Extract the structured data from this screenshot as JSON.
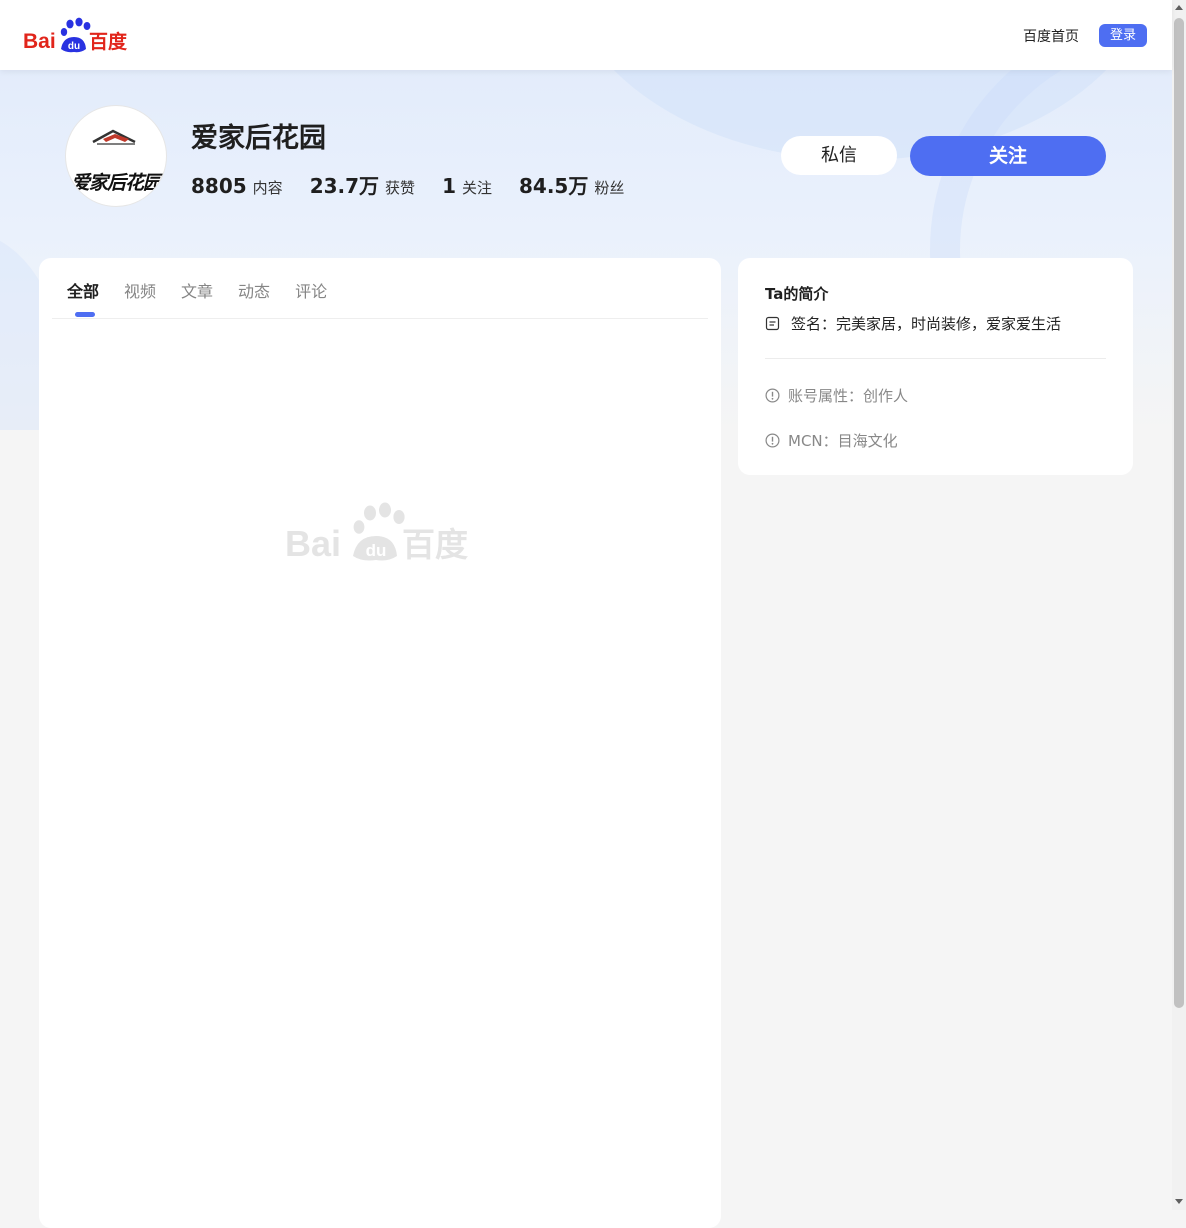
{
  "header": {
    "logo_text_left": "Bai",
    "logo_text_mid": "du",
    "logo_text_right": "百度",
    "home_link": "百度首页",
    "login_button": "登录"
  },
  "profile": {
    "avatar_text": "爱家后花园",
    "name": "爱家后花园",
    "stats": [
      {
        "value": "8805",
        "label": "内容"
      },
      {
        "value": "23.7万",
        "label": "获赞"
      },
      {
        "value": "1",
        "label": "关注"
      },
      {
        "value": "84.5万",
        "label": "粉丝"
      }
    ],
    "message_button": "私信",
    "follow_button": "关注"
  },
  "tabs": [
    {
      "label": "全部",
      "active": true
    },
    {
      "label": "视频",
      "active": false
    },
    {
      "label": "文章",
      "active": false
    },
    {
      "label": "动态",
      "active": false
    },
    {
      "label": "评论",
      "active": false
    }
  ],
  "placeholder": {
    "logo_text_left": "Bai",
    "logo_text_mid": "du",
    "logo_text_right": "百度"
  },
  "intro": {
    "title": "Ta的简介",
    "signature": "签名：完美家居，时尚装修，爱家爱生活",
    "account_type": "账号属性：创作人",
    "mcn": "MCN：目海文化"
  },
  "colors": {
    "accent": "#4e6ef2",
    "baidu_red": "#e1251b",
    "baidu_blue": "#2932e1"
  }
}
